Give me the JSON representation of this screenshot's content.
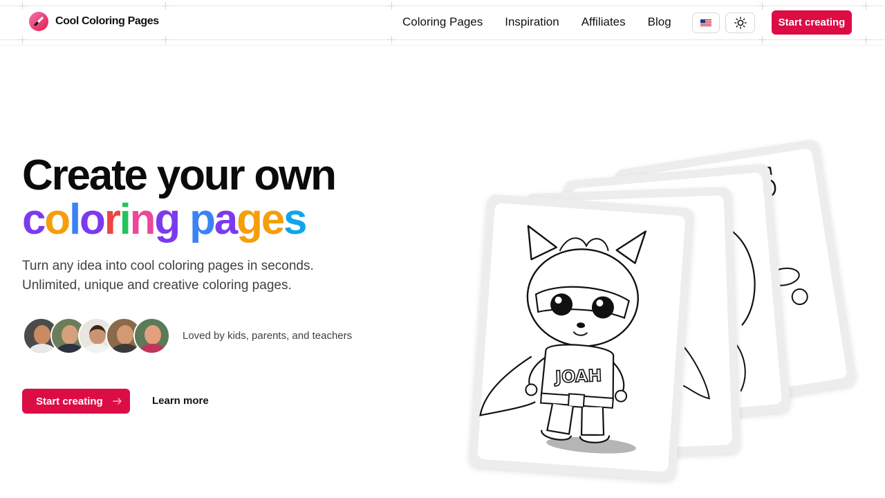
{
  "header": {
    "brand": "Cool Coloring Pages",
    "nav": [
      "Coloring Pages",
      "Inspiration",
      "Affiliates",
      "Blog"
    ],
    "language_icon": "us-flag-icon",
    "theme_icon": "sun-icon",
    "cta": "Start creating"
  },
  "hero": {
    "title_line1": "Create your own",
    "title_line2_words": [
      "coloring",
      "pages"
    ],
    "title_line2_colors": [
      "#7c3aed",
      "#f59e0b",
      "#3b82f6",
      "#7c3aed",
      "#ef4444",
      "#22c55e",
      "#ec4899",
      "#7c3aed",
      "#3b82f6",
      "#7c3aed",
      "#f59e0b",
      "#f59e0b",
      "#0ea5e9",
      "#8b5cf6"
    ],
    "subtitle_line1": "Turn any idea into cool coloring pages in seconds.",
    "subtitle_line2": "Unlimited, unique and creative coloring pages.",
    "social_proof": "Loved by kids, parents, and teachers",
    "cta_primary": "Start creating",
    "cta_secondary": "Learn more"
  },
  "colors": {
    "accent": "#dc0d45",
    "text": "#0b0b0b",
    "muted": "#3f3f46"
  },
  "illustration": {
    "badge_text": "JOAH"
  }
}
